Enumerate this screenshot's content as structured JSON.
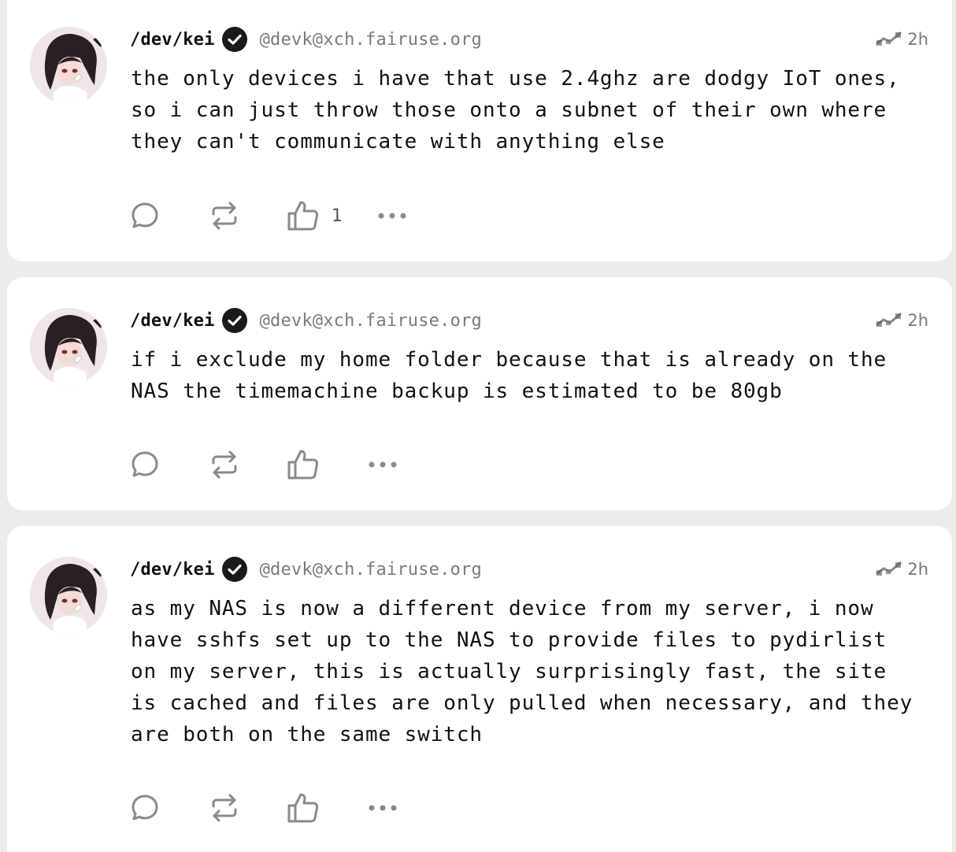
{
  "posts": [
    {
      "display_name": "/dev/kei",
      "handle": "@devk@xch.fairuse.org",
      "time": "2h",
      "content": "the only devices i have that use 2.4ghz are dodgy IoT ones,\nso i can just throw those onto a subnet of their own where\nthey can't communicate with anything else",
      "like_count": "1"
    },
    {
      "display_name": "/dev/kei",
      "handle": "@devk@xch.fairuse.org",
      "time": "2h",
      "content": "if i exclude my home folder because that is already on the\nNAS the timemachine backup is estimated to be 80gb",
      "like_count": ""
    },
    {
      "display_name": "/dev/kei",
      "handle": "@devk@xch.fairuse.org",
      "time": "2h",
      "content": "as my NAS is now a different device from my server, i now\nhave sshfs set up to the NAS to provide files to pydirlist\non my server, this is actually surprisingly fast, the site\nis cached and files are only pulled when necessary, and they\nare both on the same switch",
      "like_count": ""
    }
  ],
  "icons": {
    "verified": "verified-check-icon",
    "federated": "federated-instance-icon",
    "reply": "reply-icon",
    "boost": "boost-icon",
    "like": "thumbs-up-icon",
    "more": "more-options-icon"
  },
  "colors": {
    "background": "#ececec",
    "card": "#ffffff",
    "text": "#111111",
    "muted": "#7a7a7a",
    "icon": "#8a8a8a"
  }
}
